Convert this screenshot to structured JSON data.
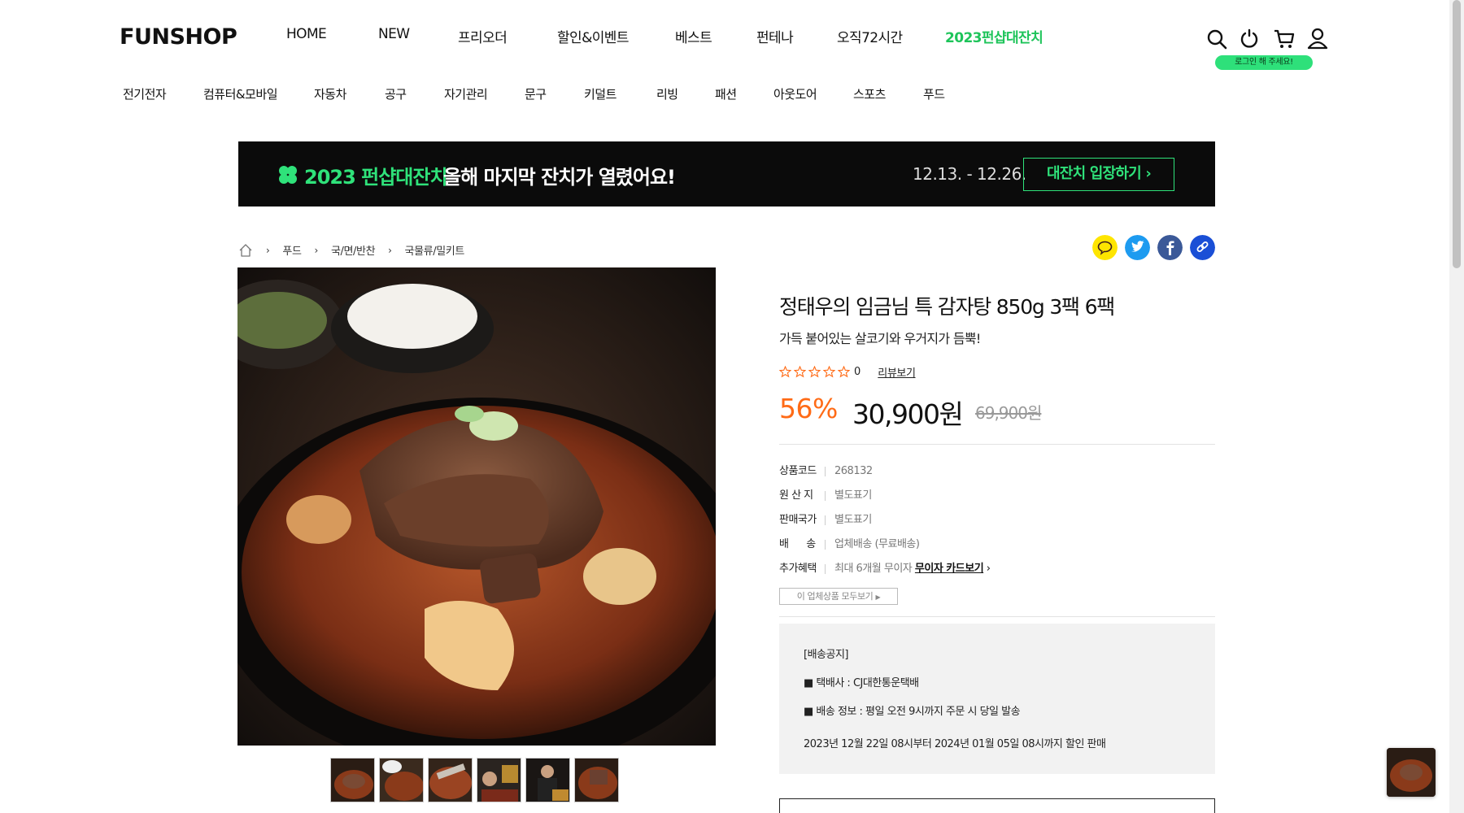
{
  "header": {
    "logo": "FUNSHOP",
    "nav": [
      "HOME",
      "NEW",
      "프리오더",
      "할인&이벤트",
      "베스트",
      "펀테나",
      "오직72시간",
      "2023펀샵대잔치"
    ],
    "login_tooltip": "로그인 해 주세요!",
    "icons": [
      "search-icon",
      "power-icon",
      "cart-icon",
      "user-icon"
    ]
  },
  "categories": [
    "전기전자",
    "컴퓨터&모바일",
    "자동차",
    "공구",
    "자기관리",
    "문구",
    "키덜트",
    "리빙",
    "패션",
    "아웃도어",
    "스포츠",
    "푸드"
  ],
  "banner": {
    "title": "2023 펀샵대잔치",
    "subtitle": "올해 마지막 잔치가 열렸어요!",
    "date": "12.13. - 12.26.",
    "button": "대잔치 입장하기",
    "accent": "#2fe27a"
  },
  "breadcrumb": [
    "푸드",
    "국/면/반찬",
    "국물류/밀키트"
  ],
  "share": [
    "kakao-icon",
    "twitter-icon",
    "facebook-icon",
    "link-icon"
  ],
  "product": {
    "title": "정태우의 임금님 특 감자탕 850g 3팩 6팩",
    "subtitle": "가득 붙어있는 살코기와 우거지가 듬뿍!",
    "rating_count": "0",
    "review_link": "리뷰보기",
    "discount": "56%",
    "price": "30,900원",
    "original_price": "69,900원",
    "info": [
      {
        "label": "상품코드",
        "value": "268132"
      },
      {
        "label": "원 산 지",
        "value": "별도표기"
      },
      {
        "label": "판매국가",
        "value": "별도표기"
      },
      {
        "label": "배      송",
        "value": "업체배송 (무료배송)"
      },
      {
        "label": "추가혜택",
        "value": "최대 6개월 무이자",
        "link": "무이자 카드보기"
      }
    ],
    "brand_button": "이 업체상품 모두보기",
    "notice": [
      "[배송공지]",
      "■ 택배사 : CJ대한통운택배",
      "■ 배송 정보 : 평일 오전 9시까지 주문 시 당일 발송",
      "2023년 12월 22일 08시부터 2024년 01월 05일 08시까지 할인 판매"
    ],
    "thumbnail_count": 6
  },
  "colors": {
    "discount": "#ff6b16",
    "accent": "#1ec45a"
  }
}
